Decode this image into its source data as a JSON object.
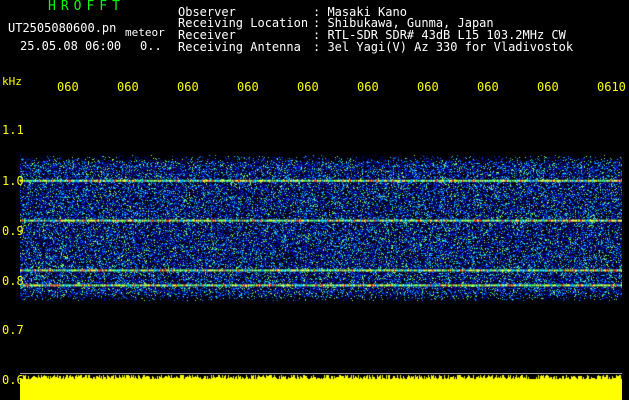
{
  "header": {
    "brand": "HROFFT",
    "filename": "UT2505080600.pn",
    "suffix": "meteor",
    "datetime": "25.05.08 06:00",
    "count": "0..",
    "labels": {
      "observer": "Observer",
      "location": "Receiving Location",
      "receiver": "Receiver",
      "antenna": "Receiving Antenna"
    },
    "values": {
      "observer": ": Masaki Kano",
      "location": ": Shibukawa, Gunma, Japan",
      "receiver": ": RTL-SDR SDR# 43dB L15 103.2MHz CW",
      "antenna": ": 3el Yagi(V) Az 330 for Vladivostok"
    }
  },
  "axis": {
    "unit": "kHz",
    "time_ticks": [
      "060",
      "060",
      "060",
      "060",
      "060",
      "060",
      "060",
      "060",
      "060",
      "0610"
    ],
    "freq_ticks": [
      "1.1",
      "1.0",
      "0.9",
      "0.8",
      "0.7",
      "0.6"
    ]
  },
  "colors": {
    "background": "#000000",
    "label": "#ffff00",
    "brand": "#00ff00",
    "text": "#ffffff",
    "noise_floor": "#ffff00"
  },
  "spectrogram": {
    "band_top_khz": 1.05,
    "band_bottom_khz": 0.76,
    "strong_lines_khz": [
      1.0,
      0.92,
      0.82,
      0.79
    ]
  }
}
